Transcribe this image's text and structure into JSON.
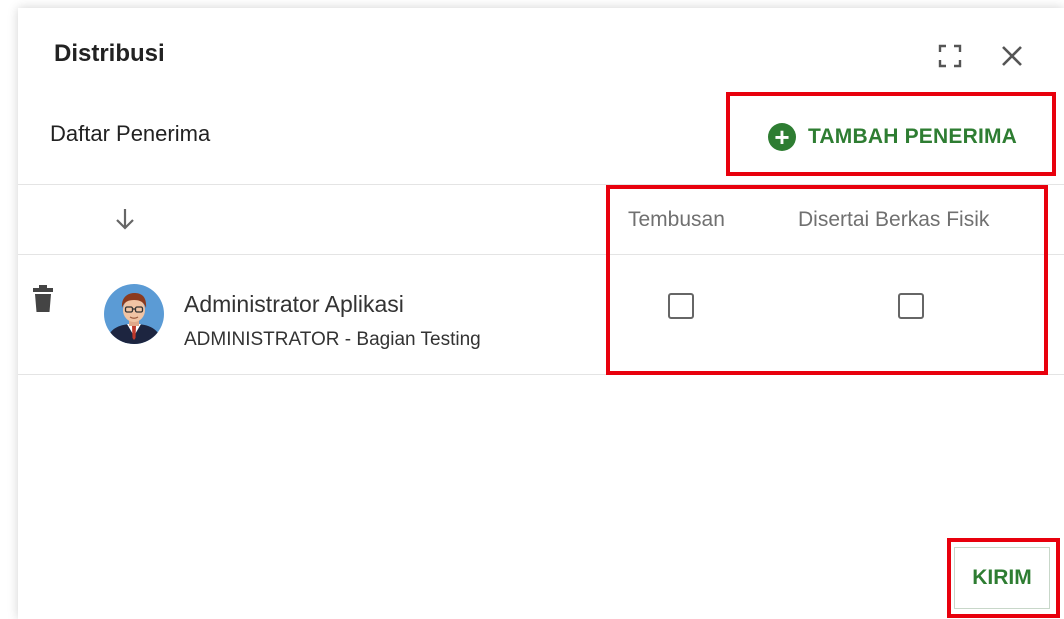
{
  "dialog": {
    "title": "Distribusi"
  },
  "recipients_section": {
    "label": "Daftar Penerima",
    "add_button_label": "TAMBAH PENERIMA",
    "add_icon": "plus-circle-icon"
  },
  "table": {
    "sort_icon": "arrow-down-icon",
    "columns": {
      "cc": "Tembusan",
      "physical": "Disertai Berkas Fisik"
    },
    "rows": [
      {
        "name": "Administrator Aplikasi",
        "subtitle": "ADMINISTRATOR - Bagian Testing",
        "cc_checked": false,
        "physical_checked": false
      }
    ]
  },
  "footer": {
    "send_label": "KIRIM"
  },
  "colors": {
    "accent_green": "#2e7d32",
    "highlight_red": "#e8000d"
  }
}
